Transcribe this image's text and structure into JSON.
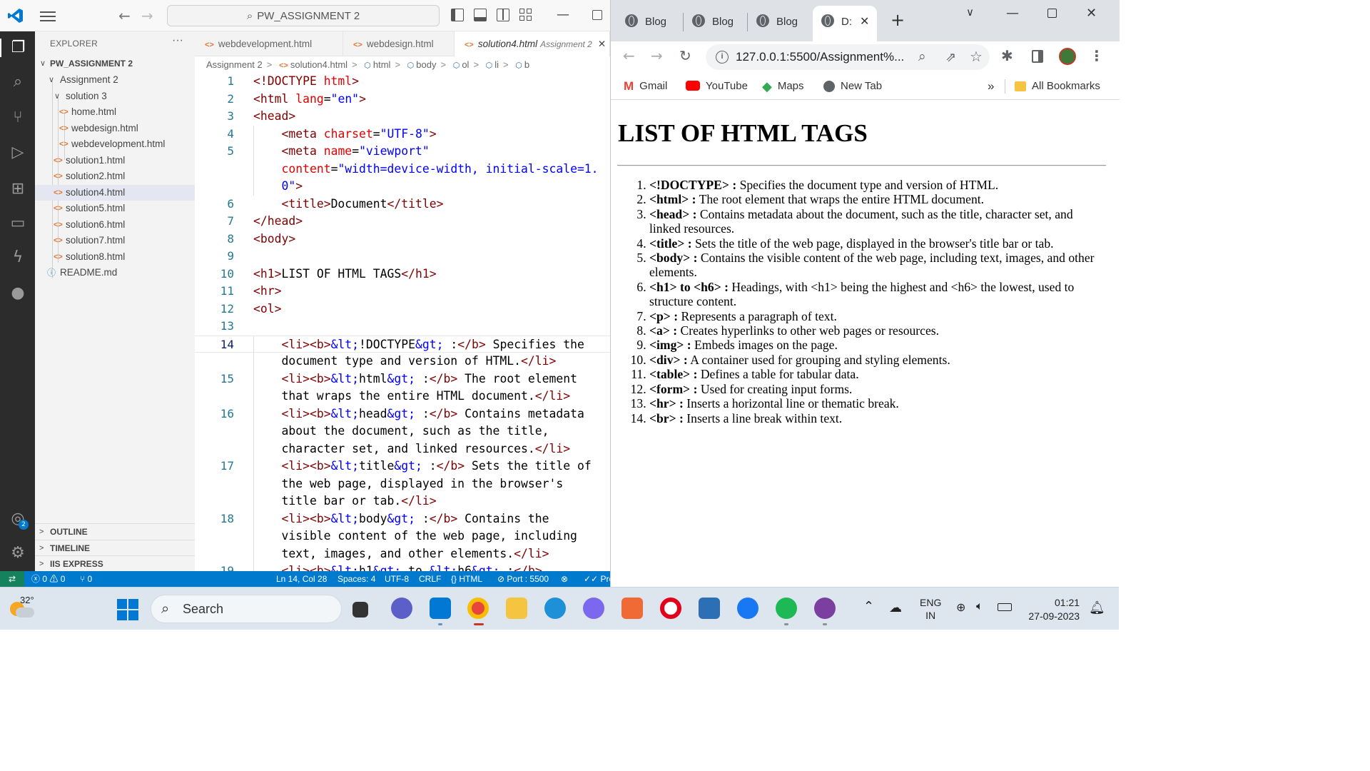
{
  "vscode": {
    "search_text": "PW_ASSIGNMENT 2",
    "explorer_title": "EXPLORER",
    "more": "···",
    "tree": [
      {
        "label": "PW_ASSIGNMENT 2",
        "chev": "∨"
      },
      {
        "label": "Assignment 2",
        "chev": "∨"
      },
      {
        "label": "solution 3",
        "chev": "∨"
      },
      {
        "label": "home.html"
      },
      {
        "label": "webdesign.html"
      },
      {
        "label": "webdevelopment.html"
      },
      {
        "label": "solution1.html"
      },
      {
        "label": "solution2.html"
      },
      {
        "label": "solution4.html"
      },
      {
        "label": "solution5.html"
      },
      {
        "label": "solution6.html"
      },
      {
        "label": "solution7.html"
      },
      {
        "label": "solution8.html"
      },
      {
        "label": "README.md"
      }
    ],
    "panels": [
      "OUTLINE",
      "TIMELINE",
      "IIS EXPRESS"
    ],
    "tabs": [
      {
        "label": "webdevelopment.html"
      },
      {
        "label": "webdesign.html"
      },
      {
        "label": "solution4.html",
        "desc": "Assignment 2"
      }
    ],
    "breadcrumb": [
      "Assignment 2",
      "solution4.html",
      "html",
      "body",
      "ol",
      "li",
      "b"
    ],
    "line_numbers": [
      "1",
      "2",
      "3",
      "4",
      "5",
      "",
      "6",
      "7",
      "8",
      "9",
      "10",
      "11",
      "12",
      "13",
      "14",
      "",
      "15",
      "",
      "16",
      "",
      "",
      "17",
      "",
      "",
      "18",
      "",
      "",
      "19"
    ],
    "status": {
      "errors": "0",
      "warnings": "0",
      "ports": "0",
      "position": "Ln 14, Col 28",
      "spaces": "Spaces: 4",
      "encoding": "UTF-8",
      "eol": "CRLF",
      "language": "HTML",
      "port": "Port : 5500",
      "prettier": "Pre"
    }
  },
  "chrome": {
    "tabs": [
      "Blog",
      "Blog",
      "Blog",
      "D:"
    ],
    "url": "127.0.0.1:5500/Assignment%...",
    "bookmarks": [
      "Gmail",
      "YouTube",
      "Maps",
      "New Tab",
      "All Bookmarks"
    ],
    "page": {
      "heading": "LIST OF HTML TAGS",
      "items": [
        {
          "tag": "<!DOCTYPE> :",
          "text": " Specifies the document type and version of HTML."
        },
        {
          "tag": "<html> :",
          "text": " The root element that wraps the entire HTML document."
        },
        {
          "tag": "<head> :",
          "text": " Contains metadata about the document, such as the title, character set, and linked resources."
        },
        {
          "tag": "<title> :",
          "text": " Sets the title of the web page, displayed in the browser's title bar or tab."
        },
        {
          "tag": "<body> :",
          "text": " Contains the visible content of the web page, including text, images, and other elements."
        },
        {
          "tag": "<h1> to <h6> :",
          "text": " Headings, with <h1> being the highest and <h6> the lowest, used to structure content."
        },
        {
          "tag": "<p> :",
          "text": " Represents a paragraph of text."
        },
        {
          "tag": "<a> :",
          "text": " Creates hyperlinks to other web pages or resources."
        },
        {
          "tag": "<img> :",
          "text": " Embeds images on the page."
        },
        {
          "tag": "<div> :",
          "text": " A container used for grouping and styling elements."
        },
        {
          "tag": "<table> :",
          "text": " Defines a table for tabular data."
        },
        {
          "tag": "<form> :",
          "text": " Used for creating input forms."
        },
        {
          "tag": "<hr> :",
          "text": " Inserts a horizontal line or thematic break."
        },
        {
          "tag": "<br> :",
          "text": " Inserts a line break within text."
        }
      ]
    }
  },
  "taskbar": {
    "temperature": "32°",
    "search": "Search",
    "language": "ENG",
    "region": "IN",
    "time": "01:21",
    "date": "27-09-2023"
  },
  "colors": {
    "vscode_accent": "#007acc",
    "vscode_activity": "#2c2c2c",
    "code_tag": "#800000",
    "code_attr": "#e50000",
    "code_string": "#0000ff"
  }
}
